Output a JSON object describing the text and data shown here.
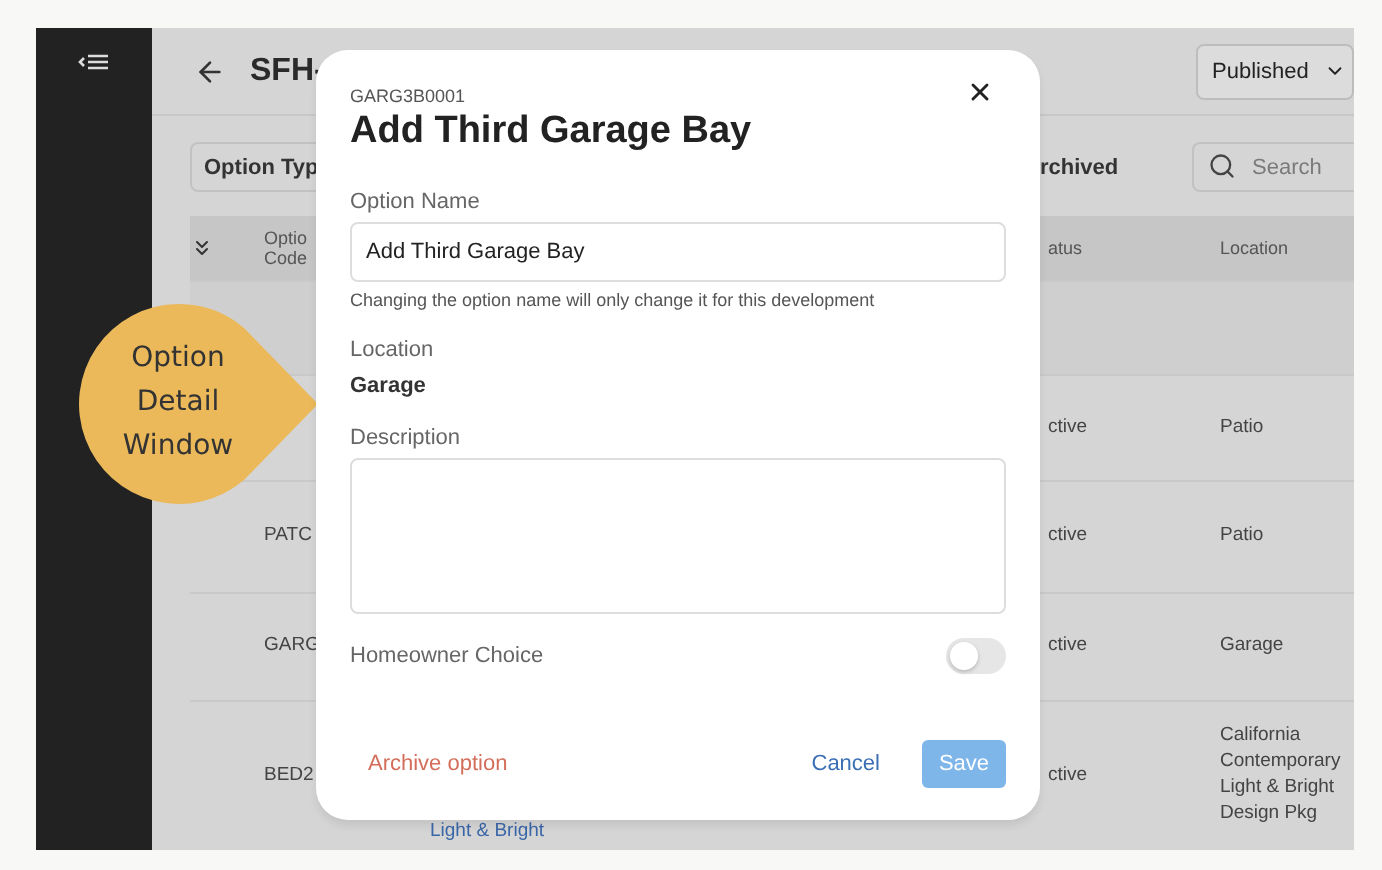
{
  "header": {
    "title": "SFH-",
    "publish_select": "Published"
  },
  "toolbar": {
    "filter_button": "Option Typ",
    "archived_label": "rchived",
    "search": {
      "placeholder": "Search"
    }
  },
  "table": {
    "columns": [
      "Optio Code",
      "atus",
      "Location"
    ],
    "rows": [
      {
        "kind": "group"
      },
      {
        "kind": "option",
        "status": "ctive",
        "location": "Patio"
      },
      {
        "kind": "option",
        "code": "PATC",
        "status": "ctive",
        "location": "Patio"
      },
      {
        "kind": "option",
        "code": "GARG",
        "status": "ctive",
        "location": "Garage"
      },
      {
        "kind": "option",
        "code": "BED2",
        "name_link": "Light & Bright",
        "status": "ctive",
        "location": "California Contemporary Light & Bright Design Pkg"
      }
    ]
  },
  "callout": {
    "text": "Option Detail Window"
  },
  "modal": {
    "code": "GARG3B0001",
    "title": "Add Third Garage Bay",
    "option_name": {
      "label": "Option Name",
      "value": "Add Third Garage Bay",
      "helper": "Changing the option name will only change it for this development"
    },
    "location": {
      "label": "Location",
      "value": "Garage"
    },
    "description": {
      "label": "Description"
    },
    "homeowner_choice": {
      "label": "Homeowner Choice",
      "on": false
    },
    "archive_link": "Archive option",
    "cancel": "Cancel",
    "save": {
      "label": "Save",
      "disabled": true
    }
  }
}
